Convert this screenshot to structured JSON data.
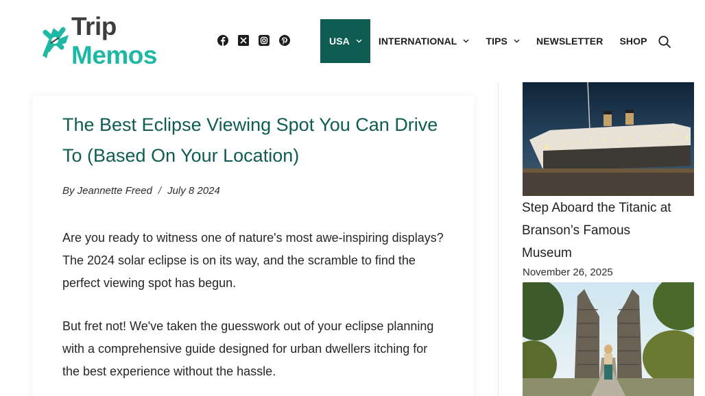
{
  "header": {
    "logo": {
      "text_part1": "Trip",
      "text_part2": "Memos"
    },
    "socials": [
      "facebook-icon",
      "x-icon",
      "instagram-icon",
      "pinterest-icon"
    ],
    "nav": [
      {
        "label": "USA",
        "dropdown": true,
        "active": true
      },
      {
        "label": "INTERNATIONAL",
        "dropdown": true,
        "active": false
      },
      {
        "label": "TIPS",
        "dropdown": true,
        "active": false
      },
      {
        "label": "NEWSLETTER",
        "dropdown": false,
        "active": false
      },
      {
        "label": "SHOP",
        "dropdown": false,
        "active": false
      }
    ],
    "search_icon": "search-icon"
  },
  "article": {
    "title": "The Best Eclipse Viewing Spot You Can Drive To (Based On Your Location)",
    "author": "By Jeannette Freed",
    "separator": "/",
    "date": "July 8 2024",
    "paragraphs": [
      "Are you ready to witness one of nature's most awe-inspiring displays? The 2024 solar eclipse is on its way, and the scramble to find the perfect viewing spot has begun.",
      "But fret not! We've taken the guesswork out of your eclipse planning with a comprehensive guide designed for urban dwellers itching for the best experience without the hassle."
    ]
  },
  "sidebar": {
    "posts": [
      {
        "title": "Step Aboard the Titanic at Branson’s Famous Museum",
        "date": "November 26, 2025"
      }
    ]
  },
  "colors": {
    "accent": "#0e5c52",
    "logo_teal": "#1fb8a4",
    "logo_dark": "#3d3d3d"
  }
}
